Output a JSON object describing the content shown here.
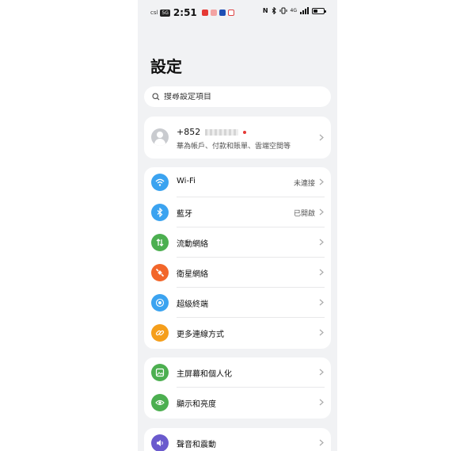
{
  "status_bar": {
    "carrier": "csl",
    "network_badge": "5G",
    "time": "2:51",
    "right_icons": [
      "nfc-icon",
      "bluetooth-icon",
      "vibrate-icon",
      "signal-icon"
    ],
    "signal_label": "4G",
    "battery_level": 0.4
  },
  "page": {
    "title": "設定"
  },
  "search": {
    "placeholder": "搜尋設定項目"
  },
  "account": {
    "number_prefix": "+852",
    "subtitle": "華為帳戶、付款和賬單、雲端空間等"
  },
  "connectivity": [
    {
      "label": "Wi-Fi",
      "value": "未連接",
      "icon": "wifi-icon",
      "color": "#3ba3f0"
    },
    {
      "label": "藍牙",
      "value": "已開啟",
      "icon": "bluetooth-icon",
      "color": "#3ba3f0"
    },
    {
      "label": "流動網絡",
      "value": "",
      "icon": "mobile-data-icon",
      "color": "#4caf50"
    },
    {
      "label": "衛星網絡",
      "value": "",
      "icon": "satellite-icon",
      "color": "#f2662a"
    },
    {
      "label": "超級終端",
      "value": "",
      "icon": "super-device-icon",
      "color": "#3ba3f0"
    },
    {
      "label": "更多連線方式",
      "value": "",
      "icon": "link-icon",
      "color": "#f59e1b"
    }
  ],
  "display": [
    {
      "label": "主屏幕和個人化",
      "icon": "wallpaper-icon",
      "color": "#4caf50"
    },
    {
      "label": "顯示和亮度",
      "icon": "eye-icon",
      "color": "#4caf50"
    }
  ],
  "sound": [
    {
      "label": "聲音和震動",
      "icon": "speaker-icon",
      "color": "#6a5acd"
    }
  ]
}
